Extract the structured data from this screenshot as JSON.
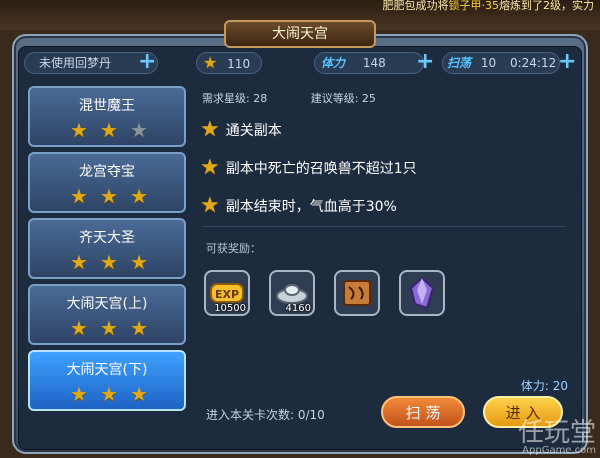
{
  "ticker": {
    "text_1": "肥肥包成功将",
    "text_2": "锁子甲·35",
    "text_3": "熔炼到了2级，实力"
  },
  "window": {
    "title": "大闹天宫"
  },
  "stats": {
    "dream_pill_label": "未使用回梦丹",
    "gold_value": "110",
    "stamina_label": "体力",
    "stamina_value": "148",
    "sweep_label": "扫荡",
    "sweep_value": "10",
    "timer": "0:24:12"
  },
  "sidebar": {
    "items": [
      {
        "label": "混世魔王",
        "stars": 2
      },
      {
        "label": "龙宫夺宝",
        "stars": 3
      },
      {
        "label": "齐天大圣",
        "stars": 3
      },
      {
        "label": "大闹天宫(上)",
        "stars": 3
      },
      {
        "label": "大闹天宫(下)",
        "stars": 3,
        "active": true
      }
    ]
  },
  "detail": {
    "required_stars": "需求星级: 28",
    "suggested_level": "建议等级: 25",
    "conditions": [
      "通关副本",
      "副本中死亡的召唤兽不超过1只",
      "副本结束时，气血高于30%"
    ],
    "reward_title": "可获奖励：",
    "rewards": [
      {
        "icon": "exp-scroll-icon",
        "count": "10500"
      },
      {
        "icon": "silver-ingot-icon",
        "count": "4160"
      },
      {
        "icon": "treasure-map-icon",
        "count": ""
      },
      {
        "icon": "purple-crystal-icon",
        "count": ""
      }
    ],
    "stamina_cost": "体力: 20",
    "entries": "进入本关卡次数: 0/10"
  },
  "buttons": {
    "sweep": "扫 荡",
    "enter": "进 入"
  },
  "watermark": {
    "main": "任玩堂",
    "sub": "AppGame.com"
  }
}
